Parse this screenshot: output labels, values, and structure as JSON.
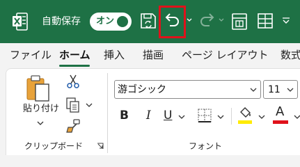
{
  "colors": {
    "titlebar": "#1e7145",
    "undo_highlight": "#e0121b",
    "fill_color": "#ffeb00",
    "font_color": "#e0121b"
  },
  "titlebar": {
    "app_icon": "excel-icon",
    "autosave_label": "自動保存",
    "autosave_state": "オン",
    "buttons": [
      "save-icon",
      "undo-icon",
      "redo-icon",
      "form-icon",
      "table-icon",
      "customize-chevron-icon"
    ]
  },
  "tabs": [
    {
      "label": "ファイル",
      "active": false
    },
    {
      "label": "ホーム",
      "active": true
    },
    {
      "label": "挿入",
      "active": false
    },
    {
      "label": "描画",
      "active": false
    },
    {
      "label": "ページ レイアウト",
      "active": false
    },
    {
      "label": "数式",
      "active": false
    }
  ],
  "clipboard": {
    "paste_label": "貼り付け",
    "group_label": "クリップボード"
  },
  "font": {
    "font_name": "游ゴシック",
    "font_size": "11",
    "bold_label": "B",
    "italic_label": "I",
    "underline_label": "U",
    "font_color_label": "A",
    "group_label": "フォント"
  }
}
